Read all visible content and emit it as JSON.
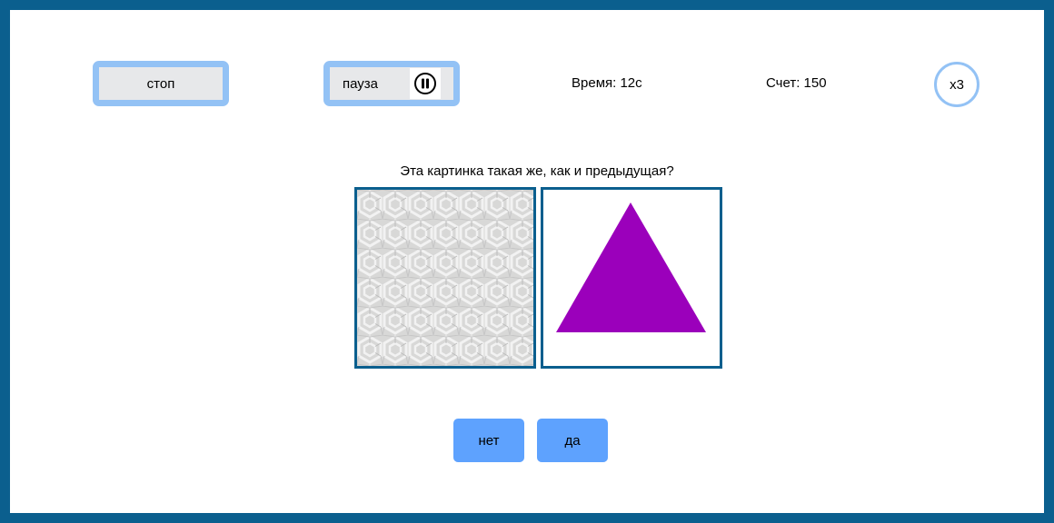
{
  "controls": {
    "stop_label": "стоп",
    "pause_label": "пауза"
  },
  "stats": {
    "time": "Время: 12с",
    "score": "Счет: 150",
    "multiplier": "x3"
  },
  "question": "Эта картинка такая же, как и предыдущая?",
  "cards": {
    "previous": {
      "icon": "geometric-pattern",
      "pattern_color": "#d9d9d9"
    },
    "current": {
      "icon": "triangle",
      "shape_color": "#9b00bb"
    }
  },
  "answers": {
    "no_label": "нет",
    "yes_label": "да"
  },
  "colors": {
    "frame": "#0b5f8e",
    "control_border": "#93c2f5",
    "answer_button": "#5ea2fe"
  }
}
